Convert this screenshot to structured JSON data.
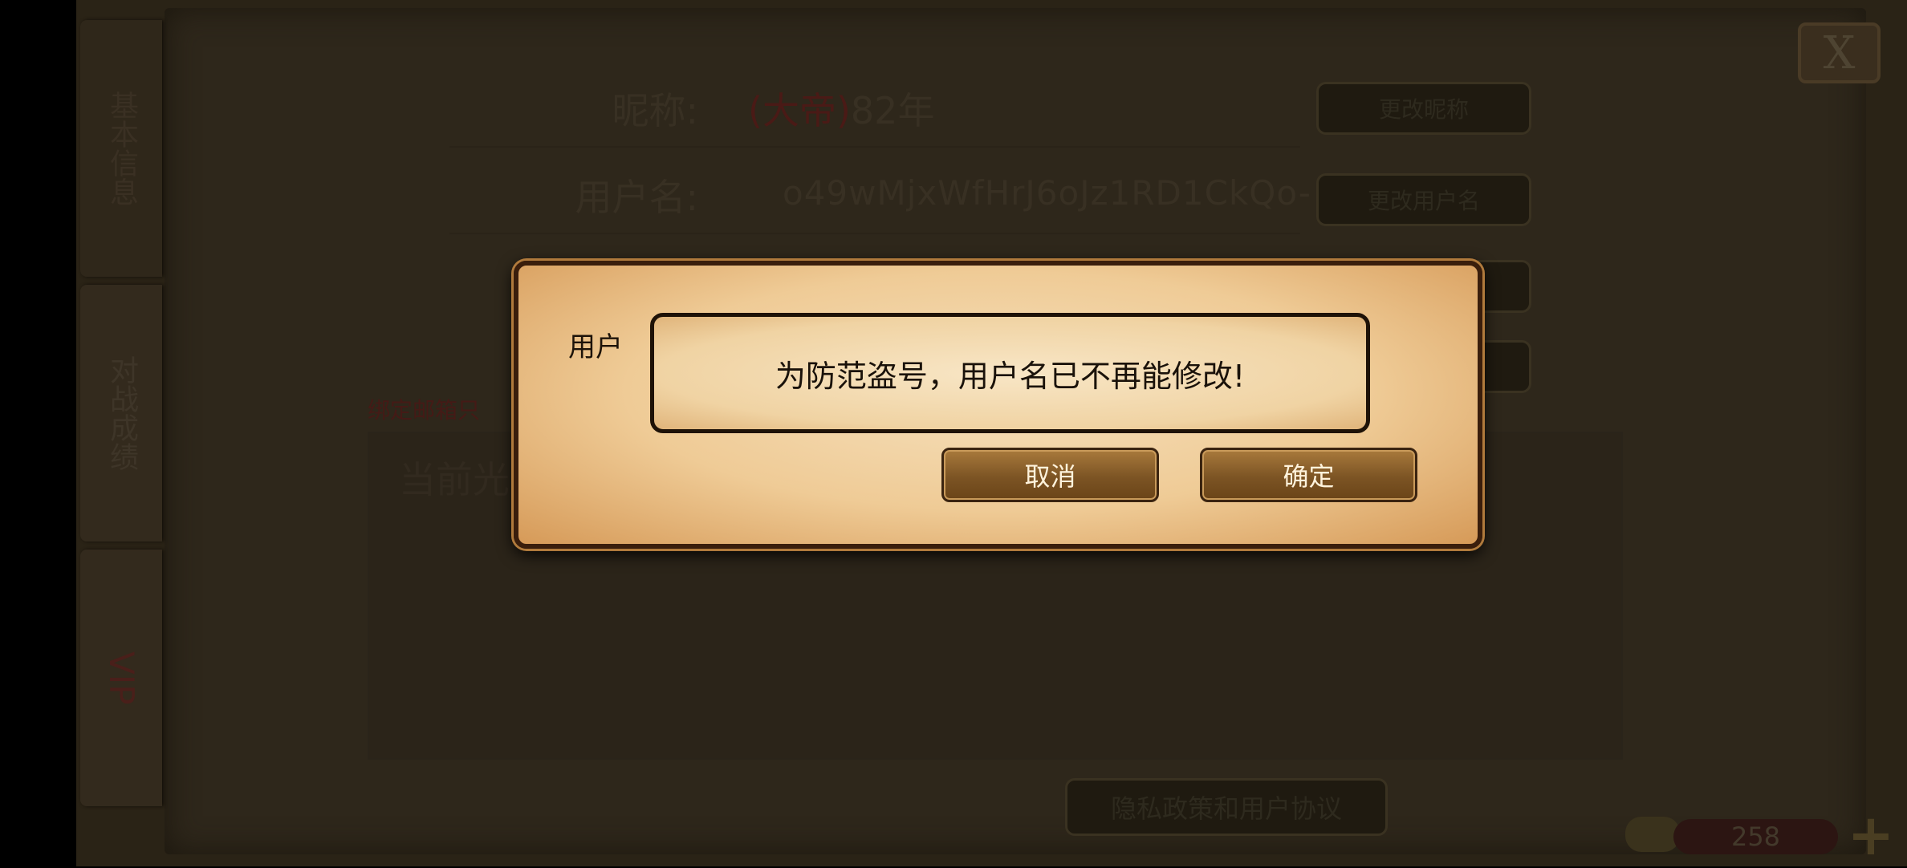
{
  "tabs": [
    {
      "label": "基本信息"
    },
    {
      "label": "对战成绩"
    },
    {
      "label": "VIP"
    }
  ],
  "profile": {
    "nickname_label": "昵称:",
    "nickname_prefix": "(大帝)",
    "nickname_value": "82年",
    "username_label": "用户名:",
    "username_value": "o49wMjxWfHrJ6oJz1RD1CkQo-",
    "change_nickname_button": "更改昵称",
    "change_username_button": "更改用户名",
    "bind_email_text": "绑定邮箱只",
    "current_text": "当前光",
    "privacy_button": "隐私政策和用户协议"
  },
  "close_label": "X",
  "coins": "258",
  "dialog": {
    "behind_label": "用户",
    "message": "为防范盗号，用户名已不再能修改!",
    "cancel": "取消",
    "confirm": "确定"
  }
}
